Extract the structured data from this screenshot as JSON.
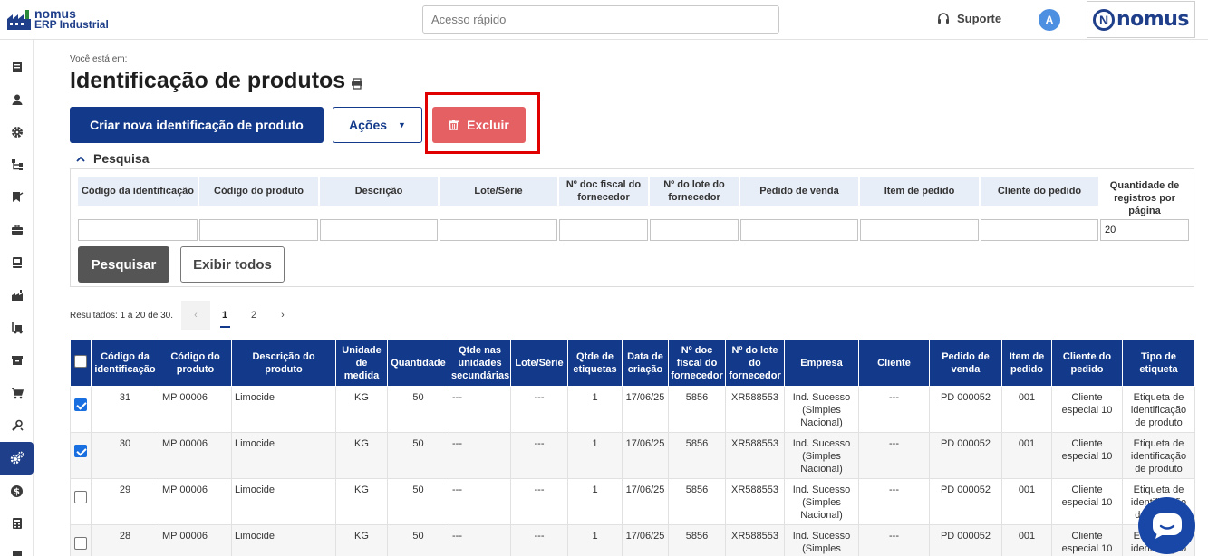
{
  "app": {
    "logo_line1": "nomus",
    "logo_line2": "ERP Industrial",
    "brand": "nomus",
    "brand_n": "N"
  },
  "header": {
    "quick_access_placeholder": "Acesso rápido",
    "support_label": "Suporte",
    "avatar_initial": "A"
  },
  "sidebar": {
    "items": [
      "document-icon",
      "user-icon",
      "gear-icon",
      "hierarchy-icon",
      "flag-icon",
      "briefcase-icon",
      "book-icon",
      "factory-icon",
      "forklift-icon",
      "box-icon",
      "cart-icon",
      "tools-icon",
      "gears-icon",
      "money-icon",
      "calculator-icon",
      "report-icon"
    ],
    "active_index": 12
  },
  "page": {
    "breadcrumb": "Você está em:",
    "title": "Identificação de produtos"
  },
  "toolbar": {
    "create_label": "Criar nova identificação de produto",
    "actions_label": "Ações",
    "delete_label": "Excluir"
  },
  "search": {
    "section_label": "Pesquisa",
    "fields": [
      {
        "label": "Código da identificação",
        "value": ""
      },
      {
        "label": "Código do produto",
        "value": ""
      },
      {
        "label": "Descrição",
        "value": ""
      },
      {
        "label": "Lote/Série",
        "value": ""
      },
      {
        "label": "Nº doc fiscal do fornecedor",
        "value": ""
      },
      {
        "label": "Nº do lote do fornecedor",
        "value": ""
      },
      {
        "label": "Pedido de venda",
        "value": ""
      },
      {
        "label": "Item de pedido",
        "value": ""
      },
      {
        "label": "Cliente do pedido",
        "value": ""
      },
      {
        "label": "Quantidade de registros por página",
        "value": "20"
      }
    ],
    "search_button": "Pesquisar",
    "show_all_button": "Exibir todos"
  },
  "pagination": {
    "results_text": "Resultados: 1 a 20 de 30.",
    "prev": "‹",
    "pages": [
      "1",
      "2"
    ],
    "next": "›",
    "current": "1"
  },
  "table": {
    "columns": [
      "Código da identificação",
      "Código do produto",
      "Descrição do produto",
      "Unidade de medida",
      "Quantidade",
      "Qtde nas unidades secundárias",
      "Lote/Série",
      "Qtde de etiquetas",
      "Data de criação",
      "Nº doc fiscal do fornecedor",
      "Nº do lote do fornecedor",
      "Empresa",
      "Cliente",
      "Pedido de venda",
      "Item de pedido",
      "Cliente do pedido",
      "Tipo de etiqueta"
    ],
    "rows": [
      {
        "checked": true,
        "cells": [
          "31",
          "MP 00006",
          "Limocide",
          "KG",
          "50",
          "---",
          "---",
          "1",
          "17/06/25",
          "5856",
          "XR588553",
          "Ind. Sucesso (Simples Nacional)",
          "---",
          "PD 000052",
          "001",
          "Cliente especial 10",
          "Etiqueta de identificação de produto"
        ]
      },
      {
        "checked": true,
        "cells": [
          "30",
          "MP 00006",
          "Limocide",
          "KG",
          "50",
          "---",
          "---",
          "1",
          "17/06/25",
          "5856",
          "XR588553",
          "Ind. Sucesso (Simples Nacional)",
          "---",
          "PD 000052",
          "001",
          "Cliente especial 10",
          "Etiqueta de identificação de produto"
        ]
      },
      {
        "checked": false,
        "cells": [
          "29",
          "MP 00006",
          "Limocide",
          "KG",
          "50",
          "---",
          "---",
          "1",
          "17/06/25",
          "5856",
          "XR588553",
          "Ind. Sucesso (Simples Nacional)",
          "---",
          "PD 000052",
          "001",
          "Cliente especial 10",
          "Etiqueta de identificação de produto"
        ]
      },
      {
        "checked": false,
        "cells": [
          "28",
          "MP 00006",
          "Limocide",
          "KG",
          "50",
          "---",
          "---",
          "1",
          "17/06/25",
          "5856",
          "XR588553",
          "Ind. Sucesso (Simples Nacional)",
          "---",
          "PD 000052",
          "001",
          "Cliente especial 10",
          "Etiqueta de identificação de produto"
        ]
      }
    ]
  },
  "colors": {
    "primary": "#12398a",
    "danger": "#e56063",
    "highlight_frame": "#e00000",
    "chat": "#1947a8"
  }
}
